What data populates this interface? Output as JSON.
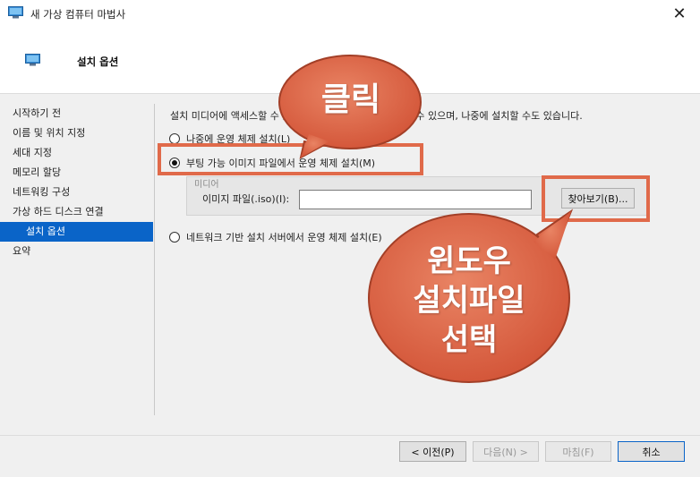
{
  "window": {
    "title": "새 가상 컴퓨터 마법사",
    "close_glyph": "✕",
    "icon": "monitor-icon"
  },
  "header": {
    "title": "설치 옵션",
    "icon": "monitor-icon"
  },
  "sidebar": {
    "items": [
      {
        "label": "시작하기 전"
      },
      {
        "label": "이름 및 위치 지정"
      },
      {
        "label": "세대 지정"
      },
      {
        "label": "메모리 할당"
      },
      {
        "label": "네트워킹 구성"
      },
      {
        "label": "가상 하드 디스크 연결"
      },
      {
        "label": "설치 옵션",
        "active": true
      },
      {
        "label": "요약"
      }
    ]
  },
  "main": {
    "description": "설치 미디어에 액세스할 수 있으면 지금 운영 체제를 설치할 수 있으며, 나중에 설치할 수도 있습니다.",
    "options": [
      {
        "label": "나중에 운영 체제 설치(L)",
        "checked": false
      },
      {
        "label": "부팅 가능 이미지 파일에서 운영 체제 설치(M)",
        "checked": true
      },
      {
        "label": "네트워크 기반 설치 서버에서 운영 체제 설치(E)",
        "checked": false
      }
    ],
    "media_group_label": "미디어",
    "iso_label": "이미지 파일(.iso)(I):",
    "iso_value": "",
    "browse_label": "찾아보기(B)..."
  },
  "footer": {
    "prev_label": "< 이전(P)",
    "next_label": "다음(N) >",
    "finish_label": "마침(F)",
    "cancel_label": "취소"
  },
  "annotations": {
    "click_text": "클릭",
    "select_text_line1": "윈도우",
    "select_text_line2": "설치파일",
    "select_text_line3": "선택",
    "color": "#e06a4a"
  },
  "colors": {
    "accent": "#0a64c8",
    "annotation": "#e06a4a"
  }
}
